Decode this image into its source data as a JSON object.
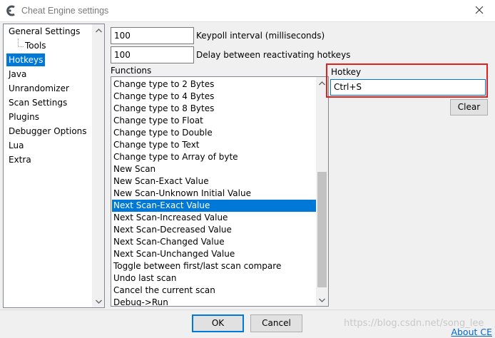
{
  "window": {
    "title": "Cheat Engine settings",
    "close_glyph": "✕"
  },
  "nav": {
    "items": [
      {
        "label": "General Settings"
      },
      {
        "label": "Tools"
      },
      {
        "label": "Hotkeys"
      },
      {
        "label": "Java"
      },
      {
        "label": "Unrandomizer"
      },
      {
        "label": "Scan Settings"
      },
      {
        "label": "Plugins"
      },
      {
        "label": "Debugger Options"
      },
      {
        "label": "Lua"
      },
      {
        "label": "Extra"
      }
    ],
    "selected": "Hotkeys"
  },
  "settings": {
    "keypoll_value": "100",
    "keypoll_label": "Keypoll interval (milliseconds)",
    "delay_value": "100",
    "delay_label": "Delay between reactivating hotkeys"
  },
  "functions": {
    "label": "Functions",
    "items": [
      "Change type to 2 Bytes",
      "Change type to 4 Bytes",
      "Change type to 8 Bytes",
      "Change type to Float",
      "Change type to Double",
      "Change type to Text",
      "Change type to Array of byte",
      "New Scan",
      "New Scan-Exact Value",
      "New Scan-Unknown Initial Value",
      "Next Scan-Exact Value",
      "Next Scan-Increased Value",
      "Next Scan-Decreased Value",
      "Next Scan-Changed Value",
      "Next Scan-Unchanged Value",
      "Toggle between first/last scan compare",
      "Undo last scan",
      "Cancel the current scan",
      "Debug->Run"
    ],
    "selected": "Next Scan-Exact Value"
  },
  "hotkey": {
    "label": "Hotkey",
    "value": "Ctrl+S",
    "clear_label": "Clear"
  },
  "footer": {
    "ok_label": "OK",
    "cancel_label": "Cancel",
    "about_label": "About CE",
    "watermark": "https://blog.csdn.net/song_lee"
  },
  "colors": {
    "selection": "#0078d7",
    "highlight_frame": "#e0201b",
    "link": "#0066cc"
  }
}
